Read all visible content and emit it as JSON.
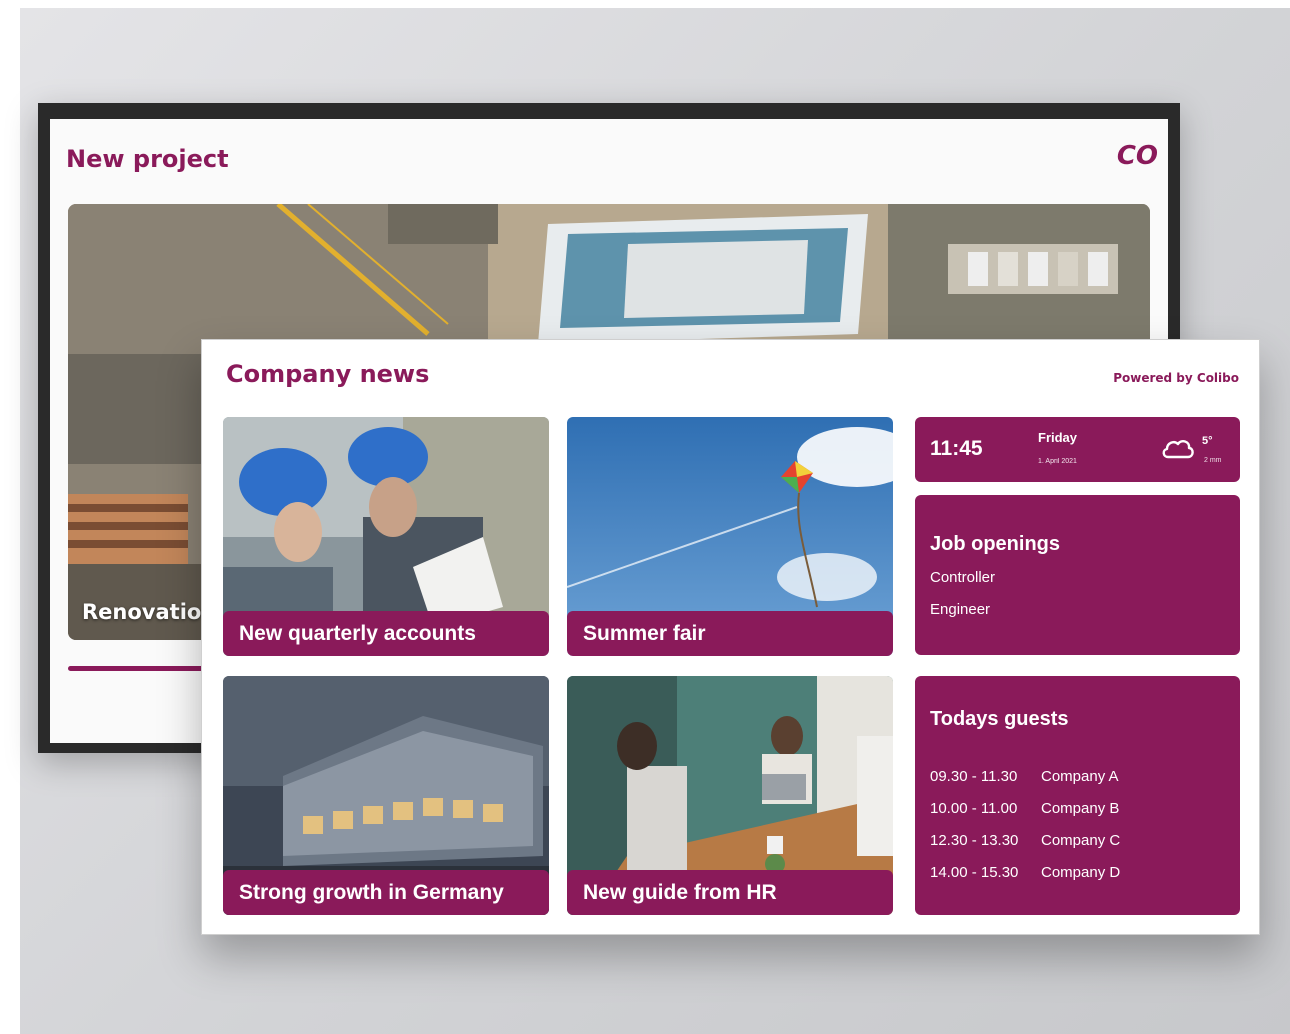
{
  "back_screen": {
    "title": "New project",
    "logo": "CO",
    "caption": "Renovatio"
  },
  "front_screen": {
    "title": "Company news",
    "powered_by": "Powered by Colibo",
    "news_cards": [
      {
        "label": "New quarterly accounts"
      },
      {
        "label": "Summer fair"
      },
      {
        "label": "Strong growth in Germany"
      },
      {
        "label": "New guide from HR"
      }
    ],
    "time_widget": {
      "time": "11:45",
      "day": "Friday",
      "date": "1. April 2021",
      "temperature": "5°",
      "precipitation": "2 mm",
      "weather_icon": "cloud-icon"
    },
    "job_openings": {
      "title": "Job openings",
      "items": [
        "Controller",
        "Engineer"
      ]
    },
    "guests": {
      "title": "Todays guests",
      "entries": [
        {
          "time": "09.30 - 11.30",
          "company": "Company A"
        },
        {
          "time": "10.00 - 11.00",
          "company": "Company B"
        },
        {
          "time": "12.30 - 13.30",
          "company": "Company C"
        },
        {
          "time": "14.00 - 15.30",
          "company": "Company D"
        }
      ]
    }
  },
  "colors": {
    "brand": "#8a1a5a",
    "background": "#d8d9dc"
  }
}
